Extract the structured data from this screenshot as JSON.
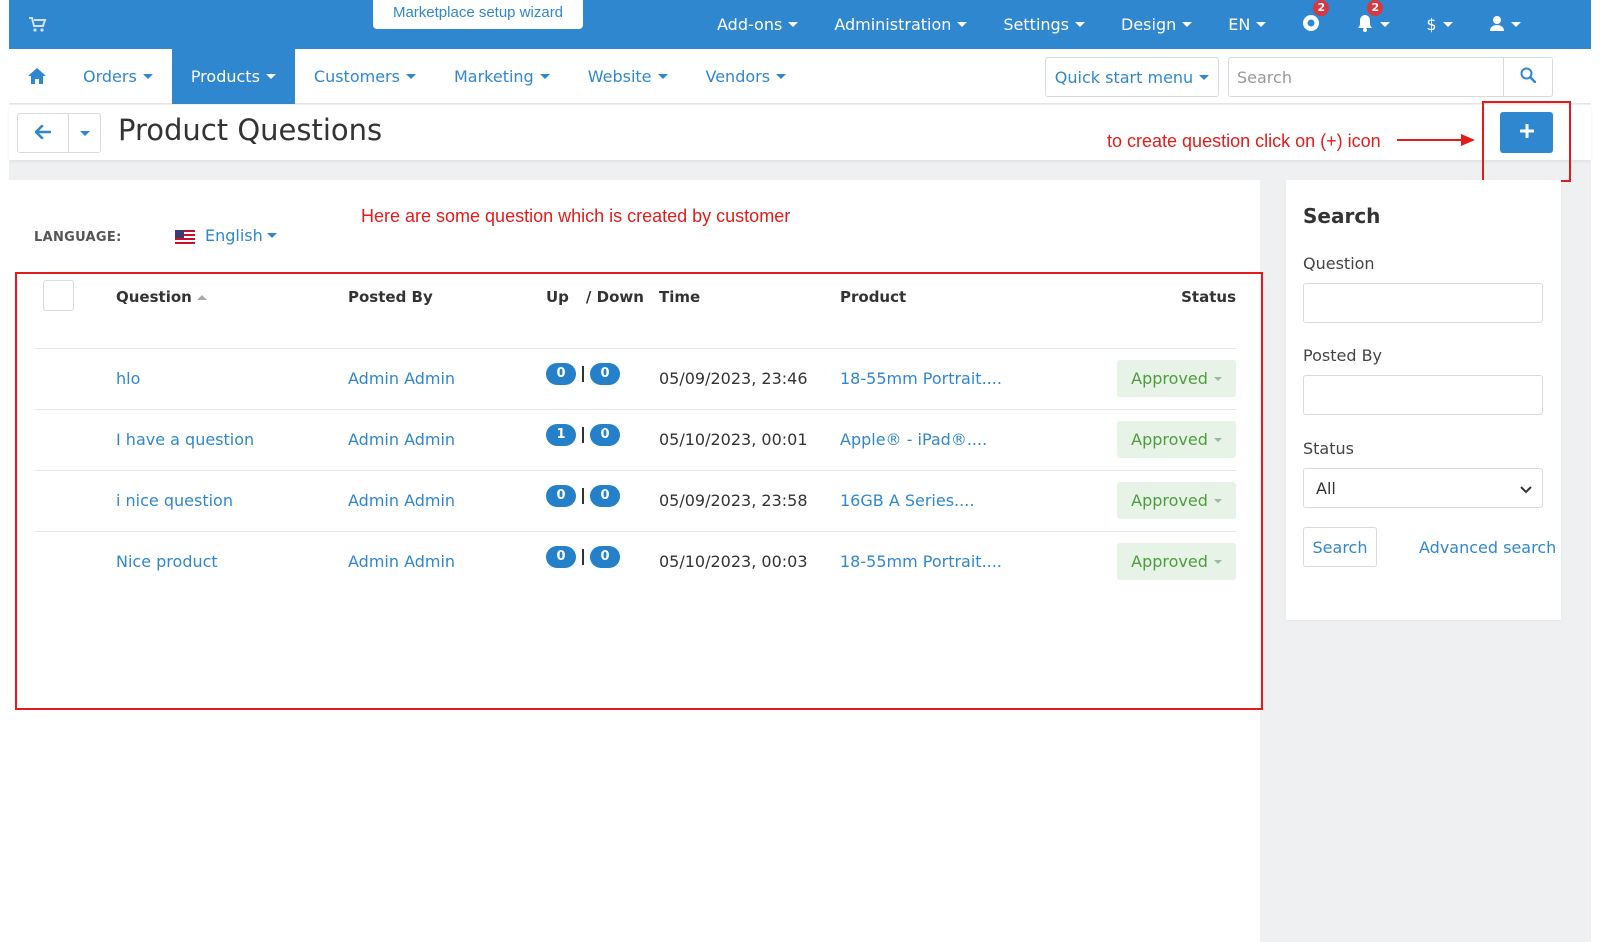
{
  "topbar": {
    "wizard_label": "Marketplace setup wizard",
    "menu": {
      "addons": "Add-ons",
      "administration": "Administration",
      "settings": "Settings",
      "design": "Design",
      "language": "EN",
      "help_badge": "2",
      "notifications_badge": "2",
      "currency": "$"
    }
  },
  "nav": {
    "items": [
      "Orders",
      "Products",
      "Customers",
      "Marketing",
      "Website",
      "Vendors"
    ],
    "quick_start": "Quick start menu",
    "search_placeholder": "Search"
  },
  "page": {
    "title": "Product Questions",
    "annotation_plus": "to create question click on (+) icon",
    "annotation_table": "Here are  some question which is created by customer"
  },
  "language": {
    "label": "LANGUAGE:",
    "value": "English"
  },
  "table": {
    "columns": {
      "question": "Question",
      "posted_by": "Posted By",
      "up": "Up",
      "down": "/ Down",
      "time": "Time",
      "product": "Product",
      "status": "Status"
    },
    "rows": [
      {
        "question": "hlo",
        "posted_by": "Admin Admin",
        "up": "0",
        "down": "0",
        "time": "05/09/2023, 23:46",
        "product": "18-55mm Portrait....",
        "status": "Approved"
      },
      {
        "question": "I have a question",
        "posted_by": "Admin Admin",
        "up": "1",
        "down": "0",
        "time": "05/10/2023, 00:01",
        "product": "Apple® - iPad®....",
        "status": "Approved"
      },
      {
        "question": "i nice question",
        "posted_by": "Admin Admin",
        "up": "0",
        "down": "0",
        "time": "05/09/2023, 23:58",
        "product": "16GB A Series....",
        "status": "Approved"
      },
      {
        "question": "Nice product",
        "posted_by": "Admin Admin",
        "up": "0",
        "down": "0",
        "time": "05/10/2023, 00:03",
        "product": "18-55mm Portrait....",
        "status": "Approved"
      }
    ]
  },
  "sidebar": {
    "title": "Search",
    "question_label": "Question",
    "posted_by_label": "Posted By",
    "status_label": "Status",
    "status_value": "All",
    "search_button": "Search",
    "advanced_search": "Advanced search"
  },
  "colors": {
    "primary": "#2f87d0",
    "annotation_red": "#e41b1b",
    "approved_bg": "#e6f3e6",
    "approved_text": "#4f9c3e"
  }
}
